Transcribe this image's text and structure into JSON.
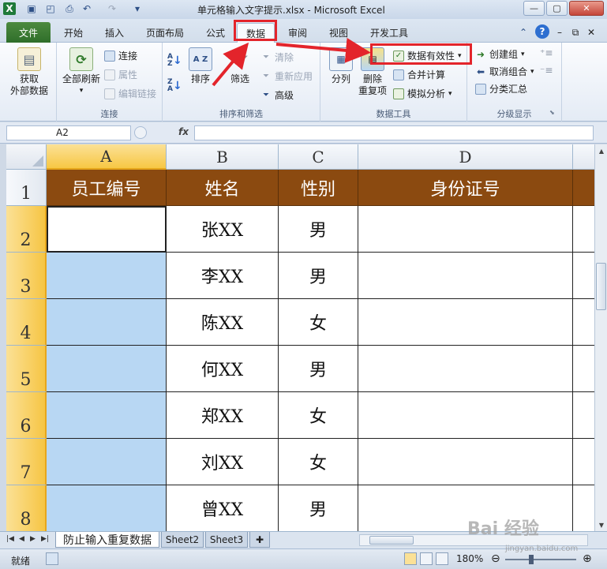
{
  "window": {
    "title": "单元格输入文字提示.xlsx - Microsoft Excel",
    "app_icon": "excel-icon",
    "quick_access": [
      "save-icon",
      "print-preview-icon",
      "print-icon",
      "undo-icon",
      "redo-icon"
    ],
    "controls": [
      "minimize",
      "restore",
      "close"
    ],
    "control_glyphs": {
      "minimize": "—",
      "restore": "▢",
      "close": "✕"
    }
  },
  "tabs": {
    "file": "文件",
    "items": [
      "开始",
      "插入",
      "页面布局",
      "公式",
      "数据",
      "审阅",
      "视图",
      "开发工具"
    ],
    "active": "数据"
  },
  "ribbon": {
    "groups": {
      "connections": "连接",
      "sort_filter": "排序和筛选",
      "data_tools": "数据工具",
      "outline": "分级显示"
    },
    "get_external": "获取\n外部数据",
    "refresh_all": "全部刷新",
    "connections": "连接",
    "properties": "属性",
    "edit_links": "编辑链接",
    "sort": "排序",
    "filter": "筛选",
    "clear": "清除",
    "reapply": "重新应用",
    "advanced": "高级",
    "text_to_columns": "分列",
    "remove_duplicates": "删除\n重复项",
    "data_validation": "数据有效性",
    "consolidate": "合并计算",
    "what_if": "模拟分析",
    "group": "创建组",
    "ungroup": "取消组合",
    "subtotal": "分类汇总",
    "sort_az": "A\nZ",
    "sort_za": "Z\nA",
    "sort_big": "A Z"
  },
  "formula_bar": {
    "name_box": "A2",
    "fx": "fx",
    "value": ""
  },
  "grid": {
    "columns": [
      "A",
      "B",
      "C",
      "D"
    ],
    "rows": [
      "1",
      "2",
      "3",
      "4",
      "5",
      "6",
      "7",
      "8"
    ],
    "headers": [
      "员工编号",
      "姓名",
      "性别",
      "身份证号"
    ],
    "data": [
      [
        "",
        "张XX",
        "男",
        ""
      ],
      [
        "",
        "李XX",
        "男",
        ""
      ],
      [
        "",
        "陈XX",
        "女",
        ""
      ],
      [
        "",
        "何XX",
        "男",
        ""
      ],
      [
        "",
        "郑XX",
        "女",
        ""
      ],
      [
        "",
        "刘XX",
        "女",
        ""
      ],
      [
        "",
        "曾XX",
        "男",
        ""
      ]
    ],
    "selected_column": "A",
    "active_cell": "A2"
  },
  "sheets": {
    "items": [
      "防止输入重复数据",
      "Sheet2",
      "Sheet3"
    ],
    "active": "防止输入重复数据"
  },
  "status": {
    "ready": "就绪",
    "zoom": "180%"
  },
  "colors": {
    "header_fill": "#8b4a10",
    "selection_fill": "#b8d7f3",
    "highlight_box": "#e3242b",
    "file_tab": "#2f6e2a"
  },
  "watermark": {
    "text": "Bai 经验",
    "sub": "jingyan.baidu.com"
  }
}
